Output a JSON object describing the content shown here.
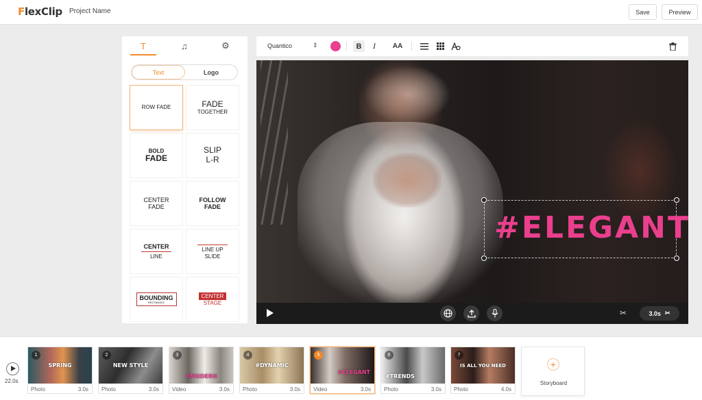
{
  "app": {
    "logo_first": "F",
    "logo_rest": "lexClip",
    "project_name": "Project Name"
  },
  "header": {
    "save_label": "Save",
    "preview_label": "Preview"
  },
  "panel": {
    "tabs": [
      {
        "icon": "text-icon",
        "glyph": "T"
      },
      {
        "icon": "music-note-icon",
        "glyph": "♫"
      },
      {
        "icon": "gear-icon",
        "glyph": "⚙"
      }
    ],
    "segments": {
      "text": "Text",
      "logo": "Logo"
    },
    "templates": [
      {
        "line1": "ROW FADE"
      },
      {
        "line1": "FADE",
        "line2": "TOGETHER"
      },
      {
        "line1": "BOLD",
        "line2": "FADE"
      },
      {
        "line1": "SLIP",
        "line2": "L-R"
      },
      {
        "line1": "CENTER",
        "line2": "FADE"
      },
      {
        "line1": "FOLLOW",
        "line2": "FADE"
      },
      {
        "line1": "CENTER",
        "line2": "LINE"
      },
      {
        "line1": "LINE UP",
        "line2": "SLIDE"
      },
      {
        "line1": "BOUNDING",
        "line2": "RECTANGLE"
      },
      {
        "line1": "CENTER",
        "line2": "STAGE"
      }
    ]
  },
  "toolbar": {
    "font_name": "Quantico",
    "text_color": "#e83f8e",
    "bold": "B",
    "italic": "I",
    "size": "AA"
  },
  "canvas": {
    "overlay_text": "#ELEGANT",
    "overlay_color": "#ea3f8d"
  },
  "player": {
    "duration": "3.0s"
  },
  "timeline": {
    "total": "22.0s",
    "clips": [
      {
        "num": "1",
        "caption": "SPRING",
        "type": "Photo",
        "duration": "3.0s"
      },
      {
        "num": "2",
        "caption": "NEW STYLE",
        "type": "Photo",
        "duration": "3.0s"
      },
      {
        "num": "3",
        "caption": "#MODERN",
        "type": "Video",
        "duration": "3.0s"
      },
      {
        "num": "4",
        "caption": "#DYNAMIC",
        "type": "Photo",
        "duration": "3.0s"
      },
      {
        "num": "5",
        "caption": "#ELEGANT",
        "type": "Video",
        "duration": "3.0s"
      },
      {
        "num": "6",
        "caption": "#TRENDS",
        "type": "Photo",
        "duration": "3.0s"
      },
      {
        "num": "7",
        "caption": "IS ALL YOU NEED",
        "type": "Photo",
        "duration": "4.0s"
      }
    ],
    "add_label": "Storyboard"
  },
  "colors": {
    "accent": "#f08a2b",
    "pink": "#ea3f8d",
    "player_bg": "#1b1b1b"
  }
}
